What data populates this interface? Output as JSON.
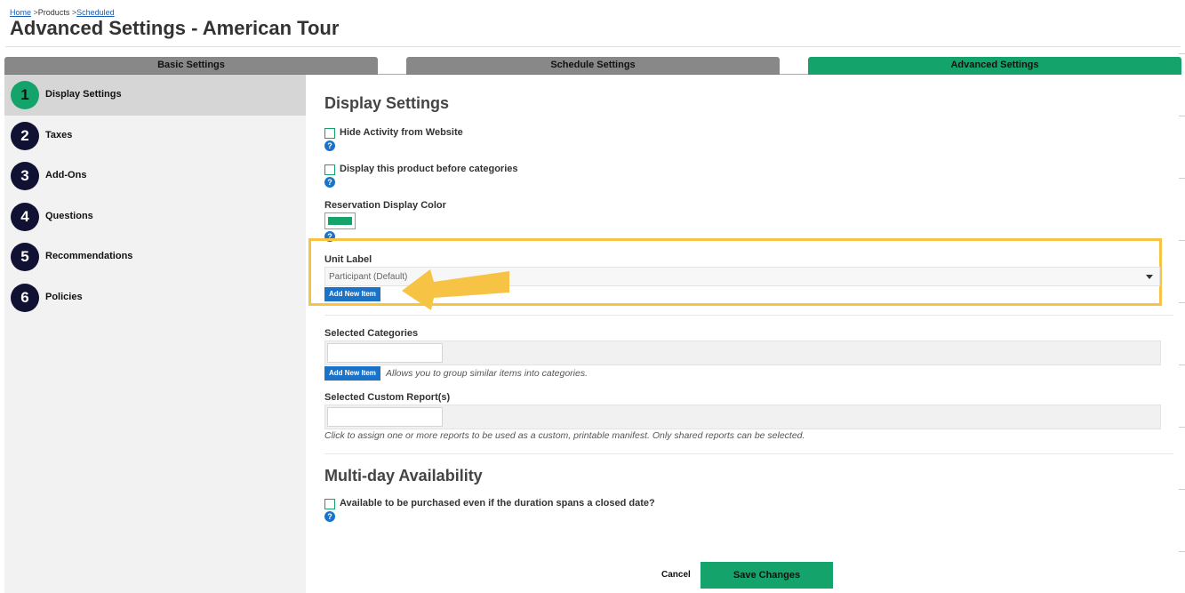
{
  "breadcrumb": {
    "home": "Home",
    "sep1": ">",
    "products": "Products",
    "sep2": ">",
    "scheduled": "Scheduled"
  },
  "page": {
    "title": "Advanced Settings - American Tour"
  },
  "tabs": [
    {
      "label": "Basic Settings",
      "active": false
    },
    {
      "label": "Schedule Settings",
      "active": false
    },
    {
      "label": "Advanced Settings",
      "active": true
    }
  ],
  "sidebar": {
    "items": [
      {
        "number": "1",
        "label": "Display Settings",
        "active": true
      },
      {
        "number": "2",
        "label": "Taxes",
        "active": false
      },
      {
        "number": "3",
        "label": "Add-Ons",
        "active": false
      },
      {
        "number": "4",
        "label": "Questions",
        "active": false
      },
      {
        "number": "5",
        "label": "Recommendations",
        "active": false
      },
      {
        "number": "6",
        "label": "Policies",
        "active": false
      }
    ]
  },
  "display_settings": {
    "title": "Display Settings",
    "hide_activity_label": "Hide Activity from Website",
    "hide_activity_checked": false,
    "display_before_label": "Display this product before categories",
    "display_before_checked": false,
    "reservation_color_label": "Reservation Display Color",
    "reservation_color": "#14a36a",
    "unit_label": "Unit Label",
    "unit_value": "Participant (Default)",
    "add_new_item": "Add New Item",
    "help_glyph": "?"
  },
  "categories": {
    "label": "Selected Categories",
    "add_new_item": "Add New Item",
    "help": "Allows you to group similar items into categories."
  },
  "reports": {
    "label": "Selected Custom Report(s)",
    "help": "Click to assign one or more reports to be used as a custom, printable manifest. Only shared reports can be selected."
  },
  "multiday": {
    "title": "Multi-day Availability",
    "available_label": "Available to be purchased even if the duration spans a closed date?",
    "available_checked": false,
    "help_glyph": "?"
  },
  "footer": {
    "cancel": "Cancel",
    "save": "Save Changes"
  },
  "colors": {
    "accent": "#14a36a",
    "tab_inactive": "#888888",
    "link": "#1a5fb4",
    "button_blue": "#1a73c9",
    "highlight": "#f6c344",
    "sidebar_badge": "#111133"
  },
  "icons": {
    "help": "help-icon",
    "arrow": "arrow-left-icon",
    "dropdown": "chevron-down-icon"
  }
}
